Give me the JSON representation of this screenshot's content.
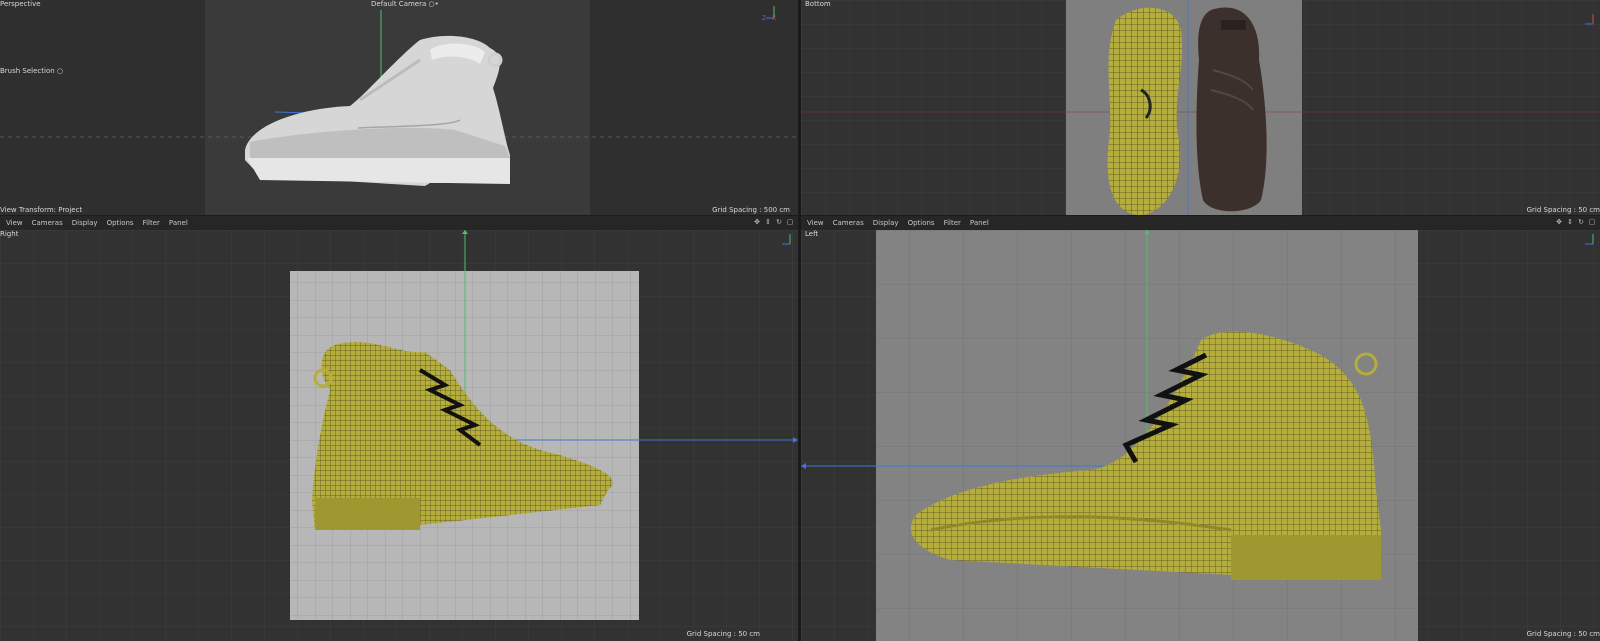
{
  "viewports": {
    "top_left": {
      "name": "Perspective",
      "camera": "Default Camera",
      "camera_suffix": "○•",
      "tool_hint": "Brush Selection",
      "tool_hint_suffix": "○",
      "view_transform": "View Transform: Project",
      "grid_spacing": "Grid Spacing : 500 cm"
    },
    "top_right": {
      "name": "Bottom",
      "grid_spacing": "Grid Spacing : 50 cm"
    },
    "bottom_left": {
      "name": "Right",
      "grid_spacing": "Grid Spacing : 50 cm"
    },
    "bottom_right": {
      "name": "Left",
      "grid_spacing": "Grid Spacing : 50 cm"
    }
  },
  "menubar": {
    "items": [
      "View",
      "Cameras",
      "Display",
      "Options",
      "Filter",
      "Panel"
    ]
  },
  "axis_labels": {
    "y": "Y",
    "z": "Z",
    "x": "X"
  },
  "icons": [
    "move-icon",
    "pan-icon",
    "rotate-icon",
    "maximize-icon"
  ],
  "colors": {
    "wireframe": "#b5ad3c",
    "axis_y": "#4fbf6b",
    "axis_z": "#3f77d6",
    "axis_x": "#d04a4a",
    "background": "#323232"
  }
}
